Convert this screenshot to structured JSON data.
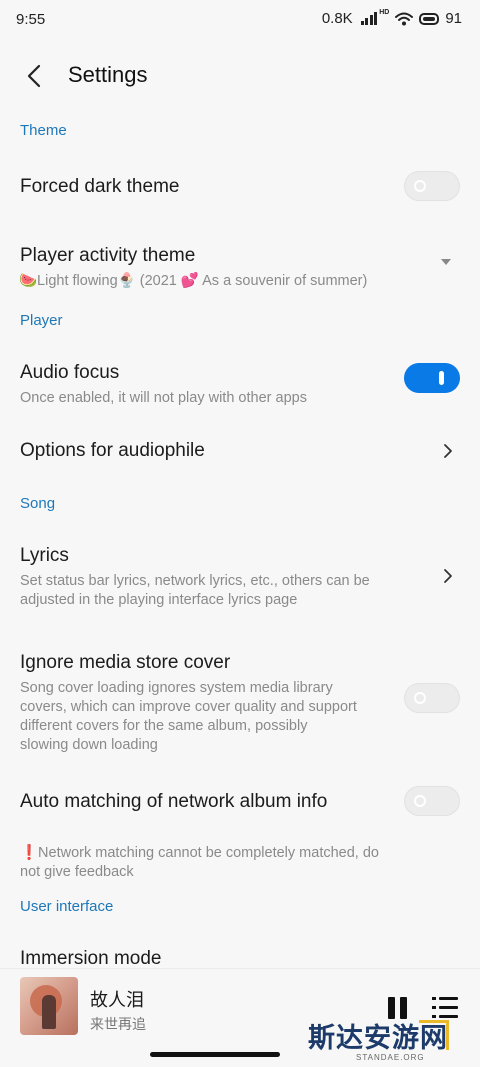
{
  "status_bar": {
    "time": "9:55",
    "speed": "0.8K",
    "network_type": "HD",
    "battery": "91",
    "icons": [
      "signal-icon",
      "wifi-icon",
      "battery-icon"
    ]
  },
  "header": {
    "title": "Settings",
    "back_icon": "arrow-left-icon"
  },
  "sections": {
    "theme": "Theme",
    "player": "Player",
    "song": "Song",
    "user_interface": "User interface"
  },
  "items": {
    "forced_dark": {
      "title": "Forced dark theme",
      "enabled": false
    },
    "player_activity": {
      "title": "Player activity theme",
      "value": "🍉Light flowing🍨 (2021 💕 As a souvenir of summer)"
    },
    "audio_focus": {
      "title": "Audio focus",
      "subtitle": "Once enabled, it will not play with other apps",
      "enabled": true
    },
    "audiophile": {
      "title": "Options for audiophile"
    },
    "lyrics": {
      "title": "Lyrics",
      "subtitle_line1": "Set status bar lyrics, network lyrics, etc., others can be",
      "subtitle_line2": "adjusted in the playing interface lyrics page"
    },
    "ignore_cover": {
      "title": "Ignore media store cover",
      "subtitle_line1": "Song cover loading ignores system media library",
      "subtitle_line2": "covers, which can improve cover quality and support",
      "subtitle_line3": "different covers for the same album, possibly",
      "subtitle_line4": "slowing down loading",
      "enabled": false
    },
    "auto_matching": {
      "title": "Auto matching of network album info",
      "enabled": false,
      "note_line1": "❗Network matching cannot be completely matched, do",
      "note_line2": "not give feedback"
    },
    "immersion": {
      "title": "Immersion mode"
    }
  },
  "player": {
    "song_title": "故人泪",
    "artist": "来世再追",
    "pause_icon": "pause-icon",
    "playlist_icon": "playlist-icon"
  },
  "watermark": {
    "text": "斯达安游网",
    "sub": "STANDAE.ORG"
  },
  "colors": {
    "accent": "#1e78b8",
    "toggle_on": "#0a7ae6",
    "background": "#f7f7f7"
  }
}
